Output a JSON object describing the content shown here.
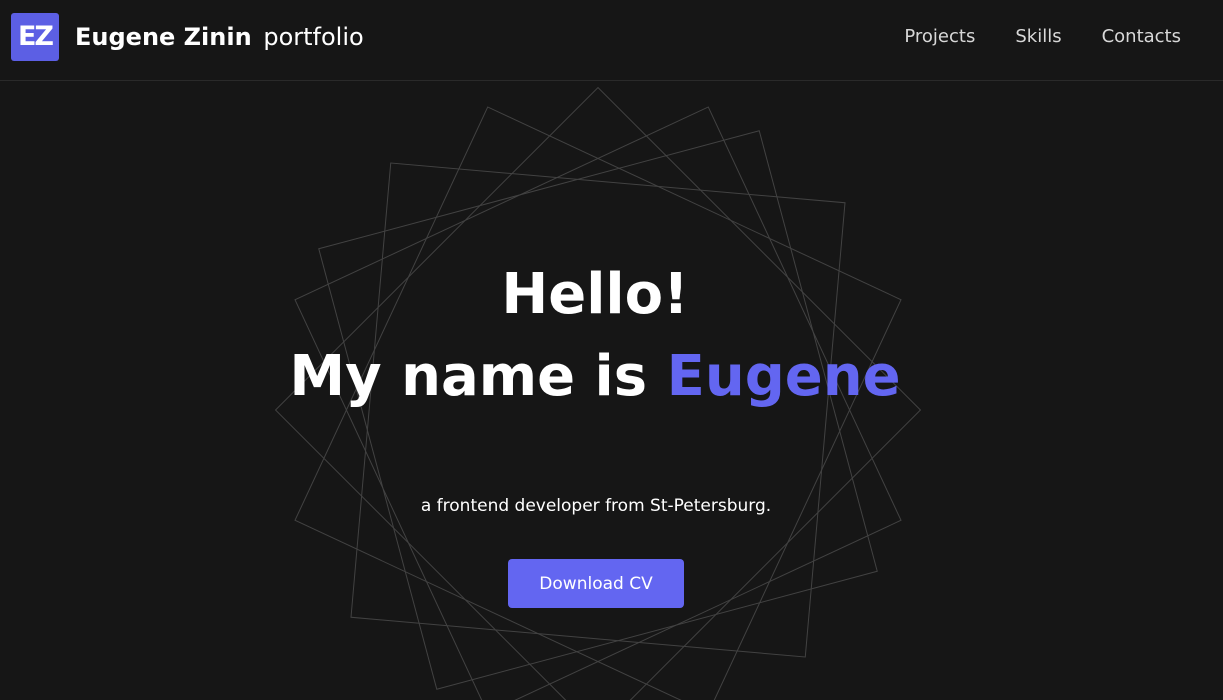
{
  "header": {
    "logo_text": "EZ",
    "brand_name": "Eugene Zinin",
    "brand_sub": "portfolio",
    "nav": [
      {
        "label": "Projects"
      },
      {
        "label": "Skills"
      },
      {
        "label": "Contacts"
      }
    ]
  },
  "hero": {
    "greeting": "Hello!",
    "intro_prefix": "My name is",
    "intro_name": "Eugene",
    "tagline": "a frontend developer from St-Petersburg.",
    "cta_label": "Download CV"
  },
  "colors": {
    "background": "#161616",
    "accent": "#6366f1",
    "text": "#ffffff"
  }
}
